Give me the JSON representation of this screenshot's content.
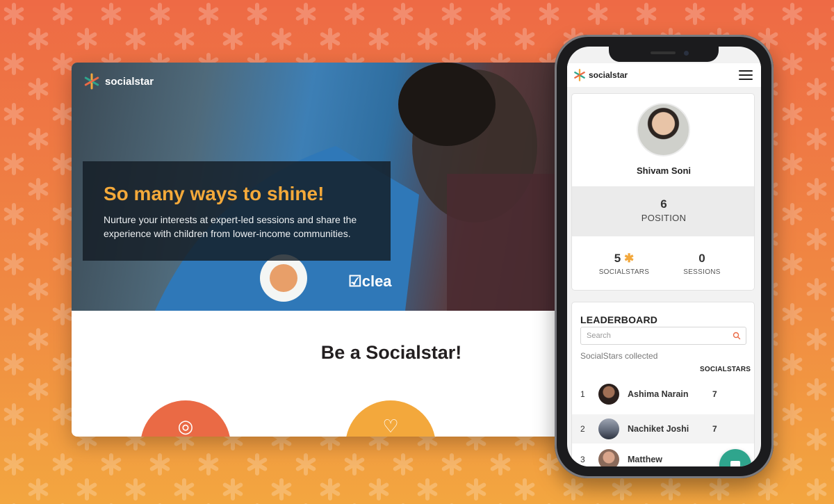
{
  "brand": {
    "name": "socialstar"
  },
  "colors": {
    "orange": "#f3a83c",
    "coral": "#ea6a45",
    "teal": "#2fa58d"
  },
  "desktop": {
    "hero_title": "So many ways to shine!",
    "hero_subtitle": "Nurture your interests at expert-led sessions and share the experience with children from lower-income communities.",
    "section_title": "Be a Socialstar!"
  },
  "phone": {
    "profile": {
      "name": "Shivam Soni",
      "position_value": "6",
      "position_label": "POSITION",
      "socialstars_value": "5",
      "socialstars_label": "SOCIALSTARS",
      "sessions_value": "0",
      "sessions_label": "SESSIONS"
    },
    "leaderboard": {
      "title": "LEADERBOARD",
      "search_placeholder": "Search",
      "subtitle": "SocialStars collected",
      "column_label": "SOCIALSTARS",
      "rows": [
        {
          "rank": "1",
          "name": "Ashima Narain",
          "value": "7"
        },
        {
          "rank": "2",
          "name": "Nachiket Joshi",
          "value": "7"
        },
        {
          "rank": "3",
          "name": "Matthew",
          "value": ""
        }
      ]
    }
  }
}
